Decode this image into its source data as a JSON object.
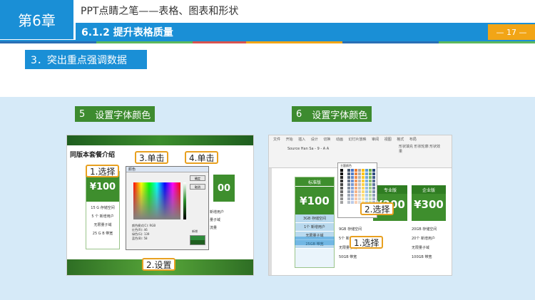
{
  "header": {
    "chapter": "第6章",
    "title": "PPT点睛之笔——表格、图表和形状",
    "section": "6.1.2  提升表格质量",
    "page": "— 17 —"
  },
  "subhead": "3．突出重点强调数据",
  "steps": [
    {
      "num": "5",
      "label": "设置字体颜色"
    },
    {
      "num": "6",
      "label": "设置字体颜色"
    }
  ],
  "left_shot": {
    "heading": "同版本套餐介绍",
    "price": "¥100",
    "price_right": "00",
    "rows": [
      "15 G 存储空间",
      "5 个 新增用户",
      "无限量子域",
      "25 G B 带宽"
    ],
    "right_rows": [
      "新增用户",
      "量子域",
      "流量"
    ],
    "dialog_title": "颜色",
    "dialog_fields": [
      "颜色模式(C):  RGB",
      "红色(R):  46",
      "绿色(G):  139",
      "蓝色(B):  58"
    ],
    "btn_ok": "确定",
    "btn_cancel": "取消",
    "new_label": "新增",
    "callouts": {
      "select": "1.选择",
      "click3": "3.单击",
      "click4": "4.单击",
      "settings": "2.设置"
    }
  },
  "right_shot": {
    "tabs": "文件  开始  插入  设计  切换  动画  幻灯片放映  审阅  视图  格式  布局",
    "font_row": "Source Han Sa - 9 - A A",
    "ribbon_right": "形状填充 形状轮廓 形状效果",
    "palette_title": "主题颜色",
    "cards": [
      {
        "head": "标准版",
        "price": "¥100",
        "sub": "per year"
      },
      {
        "head": "专业版",
        "price": "¥200",
        "sub": "per year"
      },
      {
        "head": "企业版",
        "price": "¥300",
        "sub": "per year"
      }
    ],
    "left_rows": [
      "3GB 存储空间",
      "1个 新增用户",
      "无限量子域",
      "25GB 带宽"
    ],
    "mid_rows": [
      "9GB 存储空间",
      "5个 新增用户",
      "无限量子域",
      "50GB 带宽"
    ],
    "right_rows": [
      "20GB 存储空间",
      "20个 新增用户",
      "无限量子域",
      "100GB 带宽"
    ],
    "callouts": {
      "select2": "2.选择",
      "select1": "1.选择"
    }
  },
  "colors": {
    "accent": "#1a8fd6",
    "green": "#3e8e2d",
    "orange": "#f2a516",
    "panel": "#d6eaf8"
  }
}
